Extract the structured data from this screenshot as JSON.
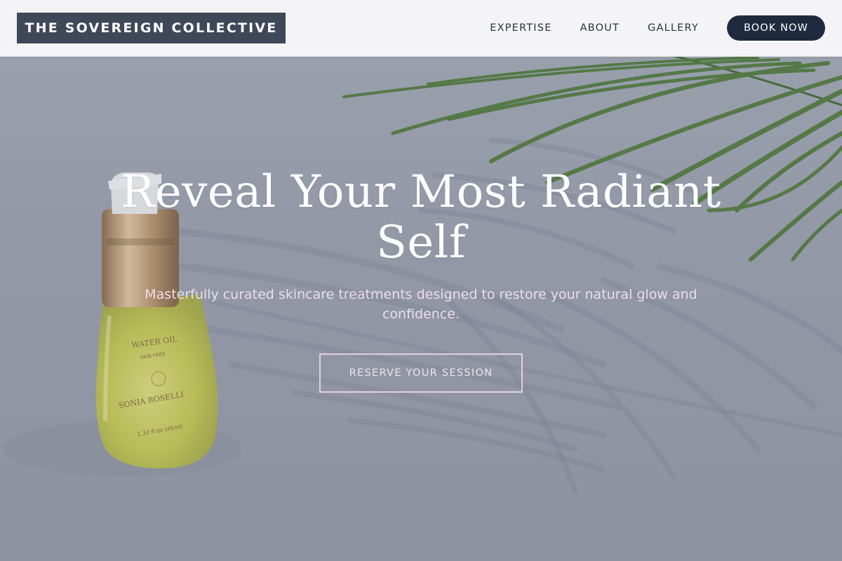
{
  "header": {
    "brand": "THE SOVEREIGN COLLECTIVE",
    "nav": [
      "EXPERTISE",
      "ABOUT",
      "GALLERY"
    ],
    "cta": "BOOK NOW"
  },
  "hero": {
    "headline": "Reveal Your Most Radiant Self",
    "subtitle": "Masterfully curated skincare treatments designed to restore your natural glow and confidence.",
    "cta": "RESERVE YOUR SESSION",
    "bottle_label": {
      "line1": "WATER OIL",
      "line2": "SKIN FREE",
      "brand": "SONIA ROSELLI",
      "volume": "1.32 fl oz (45ml)"
    }
  },
  "colors": {
    "brand_bg": "#3f4859",
    "book_bg": "#1e2a3e",
    "cta_border": "#e7cfe0",
    "subtitle": "#ecdde9"
  }
}
